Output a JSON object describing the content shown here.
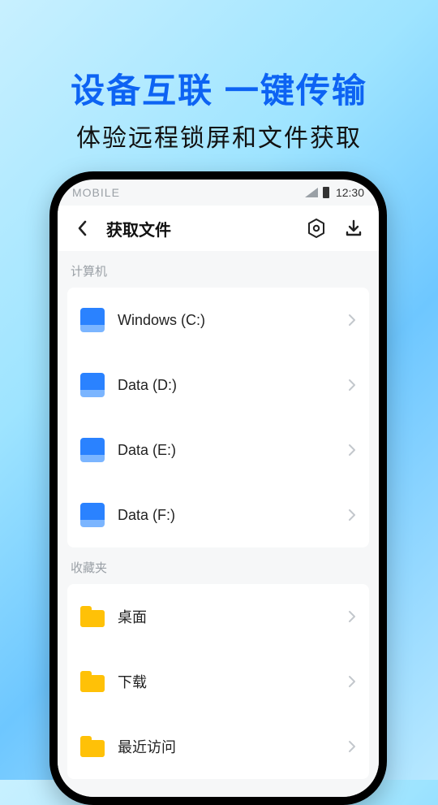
{
  "hero": {
    "title": "设备互联 一键传输",
    "subtitle": "体验远程锁屏和文件获取"
  },
  "statusbar": {
    "carrier": "MOBILE",
    "time": "12:30"
  },
  "appbar": {
    "title": "获取文件"
  },
  "sections": {
    "computer": {
      "label": "计算机"
    },
    "favorites": {
      "label": "收藏夹"
    }
  },
  "drives": [
    {
      "label": "Windows (C:)"
    },
    {
      "label": "Data (D:)"
    },
    {
      "label": "Data (E:)"
    },
    {
      "label": "Data (F:)"
    }
  ],
  "favorites": [
    {
      "label": "桌面"
    },
    {
      "label": "下载"
    },
    {
      "label": "最近访问"
    }
  ]
}
